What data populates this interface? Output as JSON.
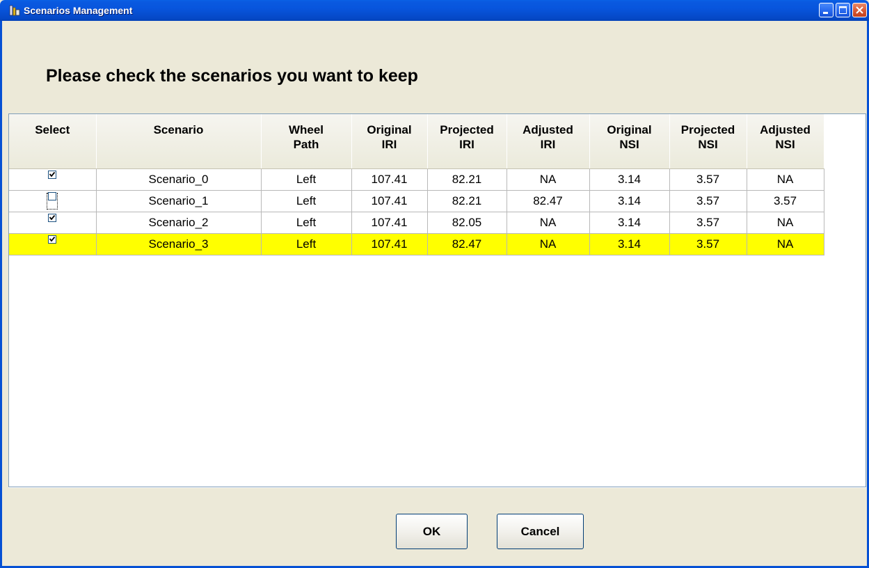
{
  "window": {
    "title": "Scenarios Management",
    "icon": "app-icon"
  },
  "instruction": "Please check the scenarios you want to keep",
  "table": {
    "headers": [
      [
        "Select"
      ],
      [
        "Scenario"
      ],
      [
        "Wheel",
        "Path"
      ],
      [
        "Original",
        "IRI"
      ],
      [
        "Projected",
        "IRI"
      ],
      [
        "Adjusted",
        "IRI"
      ],
      [
        "Original",
        "NSI"
      ],
      [
        "Projected",
        "NSI"
      ],
      [
        "Adjusted",
        "NSI"
      ]
    ],
    "rows": [
      {
        "checked": true,
        "scenario": "Scenario_0",
        "wheel_path": "Left",
        "original_iri": "107.41",
        "projected_iri": "82.21",
        "adjusted_iri": "NA",
        "original_nsi": "3.14",
        "projected_nsi": "3.57",
        "adjusted_nsi": "NA"
      },
      {
        "checked": false,
        "scenario": "Scenario_1",
        "wheel_path": "Left",
        "original_iri": "107.41",
        "projected_iri": "82.21",
        "adjusted_iri": "82.47",
        "original_nsi": "3.14",
        "projected_nsi": "3.57",
        "adjusted_nsi": "3.57"
      },
      {
        "checked": true,
        "scenario": "Scenario_2",
        "wheel_path": "Left",
        "original_iri": "107.41",
        "projected_iri": "82.05",
        "adjusted_iri": "NA",
        "original_nsi": "3.14",
        "projected_nsi": "3.57",
        "adjusted_nsi": "NA"
      },
      {
        "checked": true,
        "scenario": "Scenario_3",
        "wheel_path": "Left",
        "original_iri": "107.41",
        "projected_iri": "82.47",
        "adjusted_iri": "NA",
        "original_nsi": "3.14",
        "projected_nsi": "3.57",
        "adjusted_nsi": "NA"
      }
    ],
    "highlighted_row": 3,
    "highlight_color": "#ffff00",
    "focused_checkbox_row": 1
  },
  "buttons": {
    "ok_label": "OK",
    "cancel_label": "Cancel"
  },
  "colors": {
    "titlebar": "#0855dd",
    "dialog_bg": "#ece9d8",
    "close_button": "#d95c38"
  }
}
